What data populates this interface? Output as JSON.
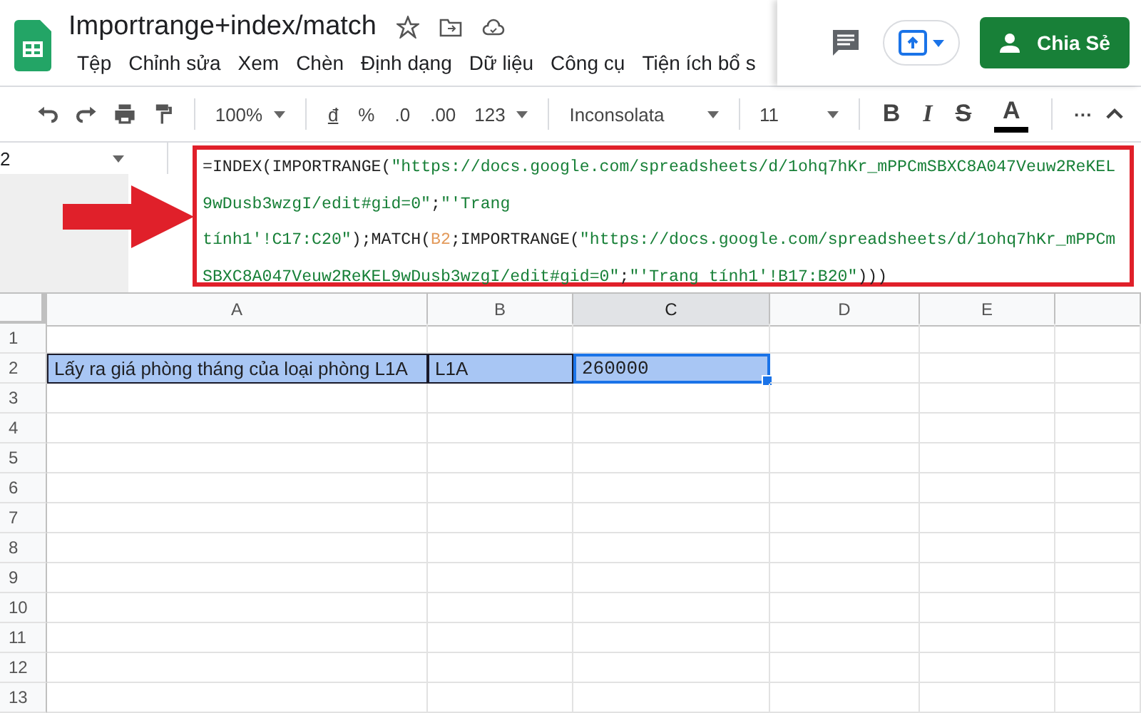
{
  "doc": {
    "title": "Importrange+index/match"
  },
  "menu": [
    "Tệp",
    "Chỉnh sửa",
    "Xem",
    "Chèn",
    "Định dạng",
    "Dữ liệu",
    "Công cụ",
    "Tiện ích bổ s"
  ],
  "share_button": {
    "label": "Chia Sẻ"
  },
  "toolbar": {
    "zoom": "100%",
    "currency": "đ",
    "percent": "%",
    "decrease_decimals": ".0",
    "increase_decimals": ".00",
    "more_formats": "123",
    "font": "Inconsolata",
    "font_size": "11",
    "bold": "B",
    "italic": "I",
    "strikethrough": "S",
    "text_color": "A",
    "more": "···"
  },
  "name_box": "2",
  "formula": [
    [
      {
        "kind": "fn",
        "text": "=INDEX(IMPORTRANGE("
      },
      {
        "kind": "str",
        "text": "\"https://docs.google.com/spreadsheets/d/1ohq7hKr_mPPCmSBXC8A047Veuw2ReKEL"
      }
    ],
    [
      {
        "kind": "str",
        "text": "9wDusb3wzgI/edit#gid=0\""
      },
      {
        "kind": "fn",
        "text": ";"
      },
      {
        "kind": "str",
        "text": "\"'Trang"
      }
    ],
    [
      {
        "kind": "str",
        "text": "tính1'!C17:C20\""
      },
      {
        "kind": "fn",
        "text": ");MATCH("
      },
      {
        "kind": "ref",
        "text": "B2"
      },
      {
        "kind": "fn",
        "text": ";IMPORTRANGE("
      },
      {
        "kind": "str",
        "text": "\"https://docs.google.com/spreadsheets/d/1ohq7hKr_mPPCm"
      }
    ],
    [
      {
        "kind": "str",
        "text": "SBXC8A047Veuw2ReKEL9wDusb3wzgI/edit#gid=0\""
      },
      {
        "kind": "fn",
        "text": ";"
      },
      {
        "kind": "str",
        "text": "\"'Trang tính1'!B17:B20\""
      },
      {
        "kind": "fn",
        "text": ")))"
      }
    ]
  ],
  "columns": [
    {
      "label": "A",
      "selected": false
    },
    {
      "label": "B",
      "selected": false
    },
    {
      "label": "C",
      "selected": true
    },
    {
      "label": "D",
      "selected": false
    },
    {
      "label": "E",
      "selected": false
    }
  ],
  "rows": [
    {
      "label": "1"
    },
    {
      "label": "2",
      "cells": [
        {
          "text": "Lấy ra giá phòng tháng của loại phòng L1A",
          "selected": true,
          "active": false
        },
        {
          "text": "L1A",
          "selected": true,
          "active": false
        },
        {
          "text": "260000",
          "selected": true,
          "active": true
        }
      ]
    },
    {
      "label": "3"
    },
    {
      "label": "4"
    },
    {
      "label": "5"
    },
    {
      "label": "6"
    },
    {
      "label": "7"
    },
    {
      "label": "8"
    },
    {
      "label": "9"
    },
    {
      "label": "10"
    },
    {
      "label": "11"
    },
    {
      "label": "12"
    },
    {
      "label": "13"
    }
  ]
}
